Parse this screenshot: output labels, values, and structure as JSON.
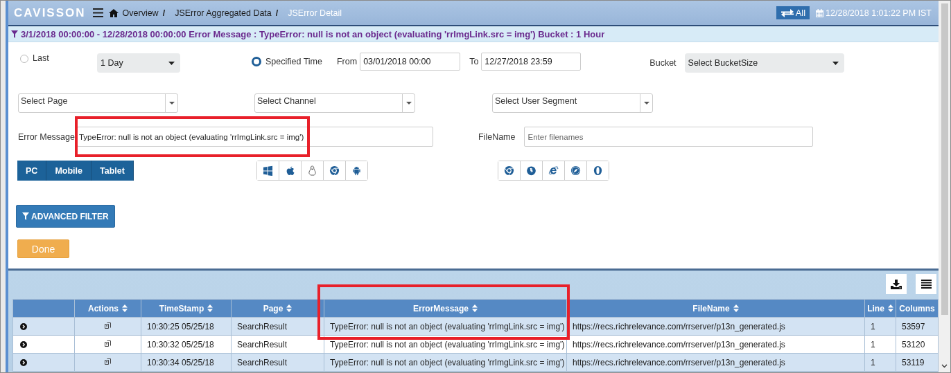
{
  "header": {
    "logo": "CAVISSON",
    "breadcrumbs": [
      {
        "label": "Overview",
        "kind": "home",
        "separator": "/"
      },
      {
        "label": "JSError Aggregated Data",
        "kind": "link",
        "separator": "/"
      },
      {
        "label": "JSError Detail",
        "kind": "current"
      }
    ],
    "scope_button": "All",
    "datetime": "12/28/2018 1:01:22 PM IST"
  },
  "summary": "3/1/2018 00:00:00 - 12/28/2018 00:00:00 Error Message : TypeError: null is not an object (evaluating 'rrImgLink.src = img') Bucket : 1 Hour",
  "form": {
    "time_mode": [
      {
        "label": "Last",
        "selected": false
      },
      {
        "label": "Specified Time",
        "selected": true
      }
    ],
    "last_duration": "1 Day",
    "from_label": "From",
    "from_value": "03/01/2018 00:00",
    "to_label": "To",
    "to_value": "12/27/2018 23:59",
    "bucket_label": "Bucket",
    "bucket_value": "Select BucketSize",
    "selects": [
      {
        "value": "Select Page"
      },
      {
        "value": "Select Channel"
      },
      {
        "value": "Select User Segment"
      }
    ],
    "error_message": {
      "label": "Error Message",
      "value": "TypeError: null is not an object (evaluating 'rrImgLink.src = img')",
      "highlighted": true
    },
    "filename": {
      "label": "FileName",
      "placeholder": "Enter filenames"
    },
    "devices": [
      {
        "label": "PC"
      },
      {
        "label": "Mobile"
      },
      {
        "label": "Tablet"
      }
    ],
    "advanced_filter": "ADVANCED FILTER",
    "done": "Done"
  },
  "table": {
    "columns": [
      {
        "sortable": false,
        "highlighted": false
      },
      {
        "label": "Actions",
        "sortable": true,
        "highlighted": false
      },
      {
        "label": "TimeStamp",
        "sortable": true,
        "highlighted": false
      },
      {
        "label": "Page",
        "sortable": true,
        "highlighted": false
      },
      {
        "label": "ErrorMessage",
        "sortable": true,
        "highlighted": true
      },
      {
        "label": "FileName",
        "sortable": true,
        "highlighted": false
      },
      {
        "label": "Line",
        "sortable": true,
        "highlighted": false
      },
      {
        "label": "Columns",
        "sortable": false,
        "highlighted": false
      }
    ],
    "rows": [
      {
        "cells": [
          "",
          "",
          "10:30:25 05/25/18",
          "SearchResult",
          "TypeError: null is not an object (evaluating 'rrImgLink.src = img')",
          "https://recs.richrelevance.com/rrserver/p13n_generated.js",
          "1",
          "53597"
        ]
      },
      {
        "cells": [
          "",
          "",
          "10:30:32 05/25/18",
          "SearchResult",
          "TypeError: null is not an object (evaluating 'rrImgLink.src = img')",
          "https://recs.richrelevance.com/rrserver/p13n_generated.js",
          "1",
          "53120"
        ]
      },
      {
        "cells": [
          "",
          "",
          "10:30:34 05/25/18",
          "SearchResult",
          "TypeError: null is not an object (evaluating 'rrImgLink.src = img')",
          "https://recs.richrelevance.com/rrserver/p13n_generated.js",
          "1",
          "53119"
        ]
      }
    ]
  }
}
